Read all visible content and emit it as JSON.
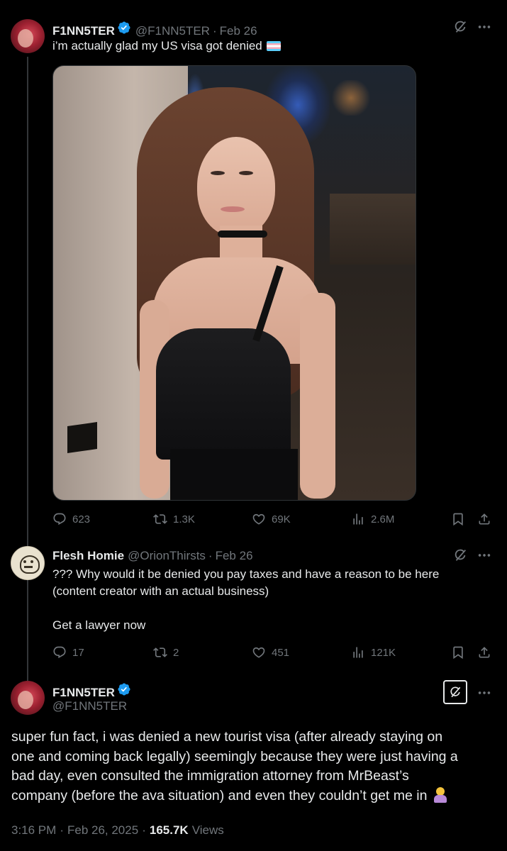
{
  "colors": {
    "background": "#000000",
    "text": "#e7e9ea",
    "muted": "#71767b",
    "verified": "#1d9bf0",
    "thread_line": "#333639"
  },
  "tweet1": {
    "display_name": "F1NN5TER",
    "handle": "@F1NN5TER",
    "sep": "·",
    "date": "Feb 26",
    "text": "i’m actually glad my US visa got denied",
    "emoji": "transgender-flag",
    "image_alt": "photo",
    "metrics": {
      "replies": "623",
      "reposts": "1.3K",
      "likes": "69K",
      "views": "2.6M"
    }
  },
  "tweet2": {
    "display_name": "Flesh Homie",
    "handle": "@OrionThirsts",
    "sep": "·",
    "date": "Feb 26",
    "text_line1": "??? Why would it be denied you pay taxes and have a reason to be here",
    "text_line2": "(content creator with an actual business)",
    "text_line3": "Get a lawyer now",
    "metrics": {
      "replies": "17",
      "reposts": "2",
      "likes": "451",
      "views": "121K"
    }
  },
  "tweet3": {
    "display_name": "F1NN5TER",
    "handle": "@F1NN5TER",
    "lines": [
      "super fun fact, i was denied a new tourist visa (after already staying on",
      "one and coming back legally) seemingly because they were just having a",
      "bad day, even consulted the immigration attorney from MrBeast’s",
      "company (before the ava situation) and even they couldn’t get me in"
    ],
    "emoji": "person-shrugging",
    "time": "3:16 PM",
    "date": "Feb 26, 2025",
    "views_count": "165.7K",
    "views_label": "Views"
  }
}
